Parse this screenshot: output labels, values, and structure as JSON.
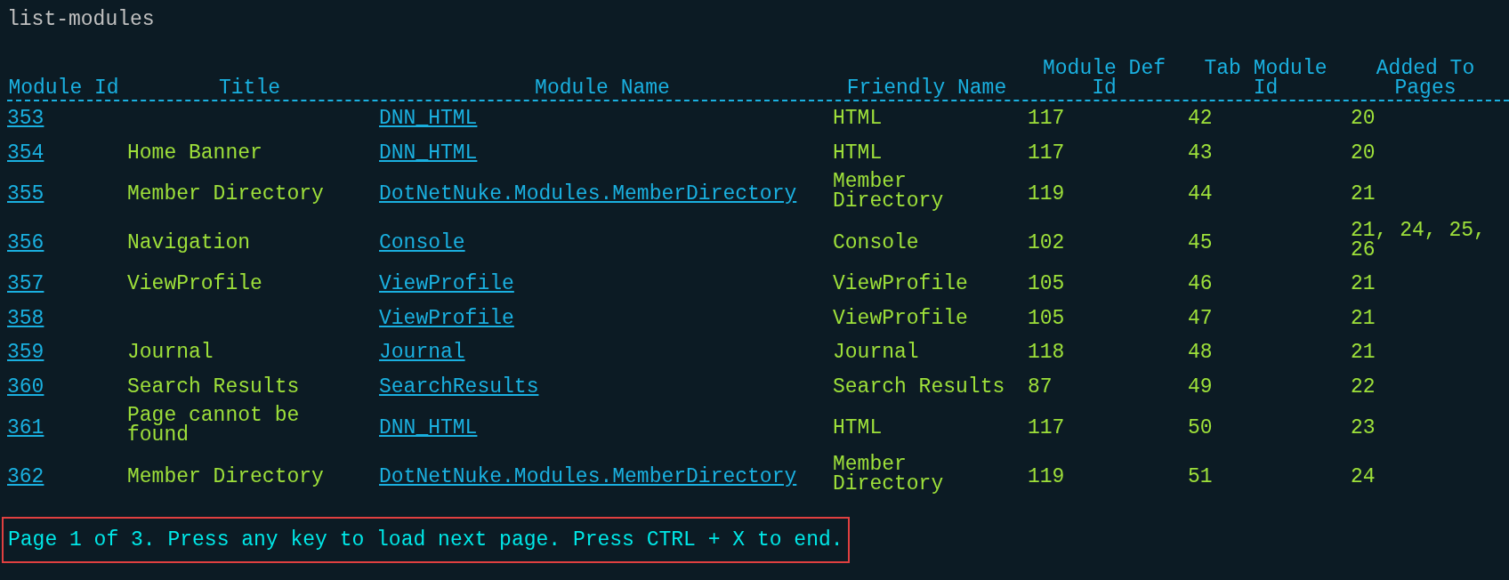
{
  "command": "list-modules",
  "table": {
    "columns": [
      "Module Id",
      "Title",
      "Module Name",
      "Friendly Name",
      "Module Def Id",
      "Tab Module Id",
      "Added To Pages"
    ],
    "rows": [
      {
        "module_id": "353",
        "title": "",
        "module_name": "DNN_HTML",
        "friendly_name": "HTML",
        "module_def_id": "117",
        "tab_module_id": "42",
        "added_to_pages": "20"
      },
      {
        "module_id": "354",
        "title": "Home Banner",
        "module_name": "DNN_HTML",
        "friendly_name": "HTML",
        "module_def_id": "117",
        "tab_module_id": "43",
        "added_to_pages": "20"
      },
      {
        "module_id": "355",
        "title": "Member Directory",
        "module_name": "DotNetNuke.Modules.MemberDirectory",
        "friendly_name": "Member Directory",
        "module_def_id": "119",
        "tab_module_id": "44",
        "added_to_pages": "21"
      },
      {
        "module_id": "356",
        "title": "Navigation",
        "module_name": "Console",
        "friendly_name": "Console",
        "module_def_id": "102",
        "tab_module_id": "45",
        "added_to_pages": "21, 24, 25, 26"
      },
      {
        "module_id": "357",
        "title": "ViewProfile",
        "module_name": "ViewProfile",
        "friendly_name": "ViewProfile",
        "module_def_id": "105",
        "tab_module_id": "46",
        "added_to_pages": "21"
      },
      {
        "module_id": "358",
        "title": "",
        "module_name": "ViewProfile",
        "friendly_name": "ViewProfile",
        "module_def_id": "105",
        "tab_module_id": "47",
        "added_to_pages": "21"
      },
      {
        "module_id": "359",
        "title": "Journal",
        "module_name": "Journal",
        "friendly_name": "Journal",
        "module_def_id": "118",
        "tab_module_id": "48",
        "added_to_pages": "21"
      },
      {
        "module_id": "360",
        "title": "Search Results",
        "module_name": "SearchResults",
        "friendly_name": "Search Results",
        "module_def_id": "87",
        "tab_module_id": "49",
        "added_to_pages": "22"
      },
      {
        "module_id": "361",
        "title": "Page cannot be found",
        "module_name": "DNN_HTML",
        "friendly_name": "HTML",
        "module_def_id": "117",
        "tab_module_id": "50",
        "added_to_pages": "23"
      },
      {
        "module_id": "362",
        "title": "Member Directory",
        "module_name": "DotNetNuke.Modules.MemberDirectory",
        "friendly_name": "Member Directory",
        "module_def_id": "119",
        "tab_module_id": "51",
        "added_to_pages": "24"
      }
    ]
  },
  "status_message": "Page 1 of 3. Press any key to load next page. Press CTRL + X to end."
}
